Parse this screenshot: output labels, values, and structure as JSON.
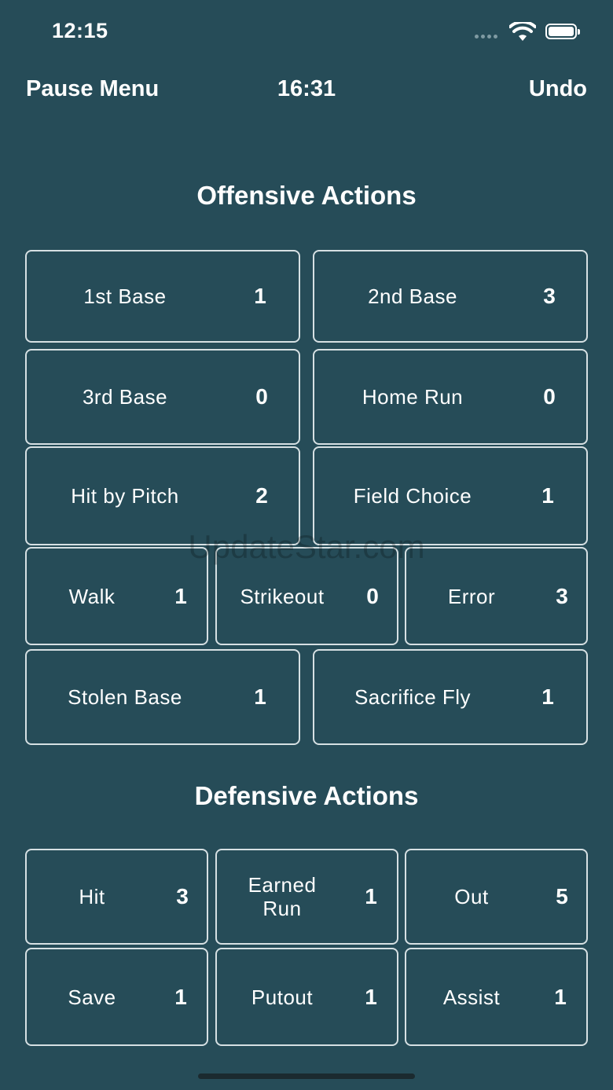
{
  "status_bar": {
    "time": "12:15"
  },
  "nav": {
    "pause_menu": "Pause Menu",
    "timer": "16:31",
    "undo": "Undo"
  },
  "offensive": {
    "title": "Offensive Actions",
    "buttons": [
      {
        "label": "1st Base",
        "count": "1"
      },
      {
        "label": "2nd Base",
        "count": "3"
      },
      {
        "label": "3rd Base",
        "count": "0"
      },
      {
        "label": "Home Run",
        "count": "0"
      },
      {
        "label": "Hit by Pitch",
        "count": "2"
      },
      {
        "label": "Field Choice",
        "count": "1"
      },
      {
        "label": "Walk",
        "count": "1"
      },
      {
        "label": "Strikeout",
        "count": "0"
      },
      {
        "label": "Error",
        "count": "3"
      },
      {
        "label": "Stolen Base",
        "count": "1"
      },
      {
        "label": "Sacrifice Fly",
        "count": "1"
      }
    ]
  },
  "defensive": {
    "title": "Defensive Actions",
    "buttons": [
      {
        "label": "Hit",
        "count": "3"
      },
      {
        "label": "Earned\nRun",
        "count": "1"
      },
      {
        "label": "Out",
        "count": "5"
      },
      {
        "label": "Save",
        "count": "1"
      },
      {
        "label": "Putout",
        "count": "1"
      },
      {
        "label": "Assist",
        "count": "1"
      }
    ]
  },
  "watermark": "UpdateStar.com",
  "colors": {
    "background": "#264c58",
    "border": "#d6e0e3",
    "text": "#ffffff"
  }
}
